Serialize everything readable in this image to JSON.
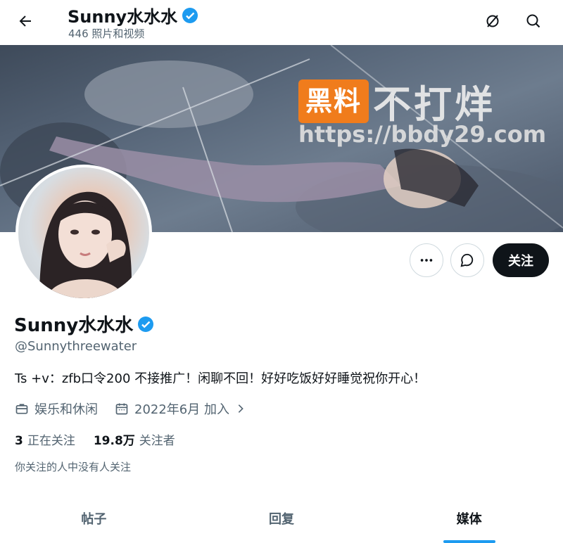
{
  "header": {
    "back_icon": "arrow-left-icon",
    "title": "Sunny水水水",
    "subtitle": "446 照片和视频",
    "icons": [
      "grok-icon",
      "search-icon"
    ]
  },
  "banner": {
    "watermark_badge": "黑料",
    "watermark_text": "不打烊",
    "watermark_url": "https://bbdy29.com"
  },
  "actions": {
    "more_icon": "more-icon",
    "message_icon": "message-icon",
    "follow_label": "关注"
  },
  "profile": {
    "name": "Sunny水水水",
    "verified_icon": "verified-badge-icon",
    "handle": "@Sunnythreewater",
    "bio": "Ts +v：zfb口令200 不接推广！闲聊不回！好好吃饭好好睡觉祝你开心！",
    "category": "娱乐和休闲",
    "joined": "2022年6月 加入",
    "following_count": "3",
    "following_label": "正在关注",
    "followers_count": "19.8万",
    "followers_label": "关注者",
    "mutual_note": "你关注的人中没有人关注"
  },
  "tabs": [
    {
      "label": "帖子",
      "active": false
    },
    {
      "label": "回复",
      "active": false
    },
    {
      "label": "媒体",
      "active": true
    }
  ],
  "colors": {
    "accent": "#1d9bf0",
    "text": "#0f1419",
    "muted": "#536471",
    "watermark": "#f07c1c"
  }
}
